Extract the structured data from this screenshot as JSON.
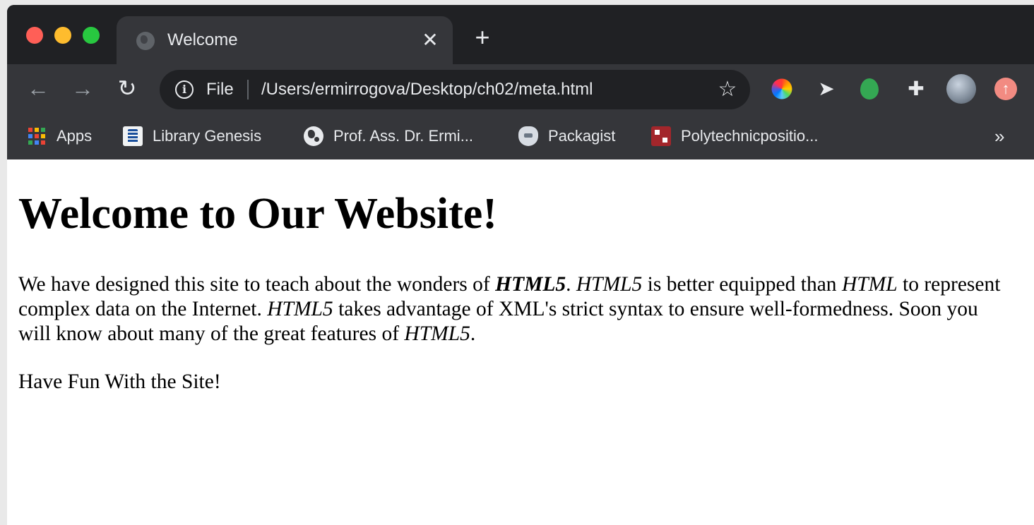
{
  "tab": {
    "title": "Welcome",
    "close_glyph": "✕",
    "new_tab_glyph": "+"
  },
  "toolbar": {
    "back_glyph": "←",
    "forward_glyph": "→",
    "reload_glyph": "↻",
    "scheme_label": "File",
    "url": "/Users/ermirrogova/Desktop/ch02/meta.html",
    "star_glyph": "☆",
    "extensions": [
      "color-wheel-icon",
      "cursor-icon",
      "green-leaf-icon",
      "puzzle-icon",
      "profile-avatar",
      "update-icon"
    ]
  },
  "bookmarks": {
    "items": [
      {
        "label": "Apps",
        "icon": "apps-grid-icon"
      },
      {
        "label": "Library Genesis",
        "icon": "library-genesis-icon"
      },
      {
        "label": "Prof. Ass. Dr. Ermi...",
        "icon": "globe-icon"
      },
      {
        "label": "Packagist",
        "icon": "packagist-icon"
      },
      {
        "label": "Polytechnicpositio...",
        "icon": "polytechnic-icon"
      }
    ],
    "overflow_glyph": "»"
  },
  "page": {
    "heading": "Welcome to Our Website!",
    "para1": [
      "We have designed this site to teach about the wonders of ",
      "HTML5",
      ". ",
      "HTML5",
      " is better equipped than ",
      "HTML",
      " to represent complex data on the Internet. ",
      "HTML5",
      " takes advantage of XML's strict syntax to ensure well-formedness. Soon you will know about many of the great features of ",
      "HTML5",
      "."
    ],
    "para2": "Have Fun With the Site!"
  },
  "colors": {
    "titlebar": "#202124",
    "toolbar": "#35363a",
    "text_light": "#e8eaed",
    "close_red": "#ff5f57",
    "minimize_yellow": "#febc2e",
    "zoom_green": "#28c840"
  }
}
